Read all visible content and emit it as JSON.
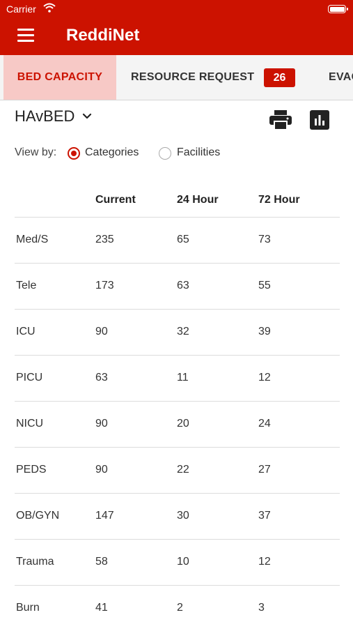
{
  "status_bar": {
    "carrier": "Carrier"
  },
  "app": {
    "title": "ReddiNet"
  },
  "tabs": [
    {
      "label": "BED CAPACITY",
      "active": true
    },
    {
      "label": "RESOURCE REQUEST",
      "badge": "26"
    },
    {
      "label": "EVAC"
    }
  ],
  "selector": {
    "label": "HAvBED"
  },
  "view_by": {
    "label": "View by:",
    "options": [
      {
        "label": "Categories",
        "selected": true
      },
      {
        "label": "Facilities",
        "selected": false
      }
    ]
  },
  "table": {
    "headers": [
      "",
      "Current",
      "24 Hour",
      "72 Hour"
    ],
    "rows": [
      [
        "Med/S",
        "235",
        "65",
        "73"
      ],
      [
        "Tele",
        "173",
        "63",
        "55"
      ],
      [
        "ICU",
        "90",
        "32",
        "39"
      ],
      [
        "PICU",
        "63",
        "11",
        "12"
      ],
      [
        "NICU",
        "90",
        "20",
        "24"
      ],
      [
        "PEDS",
        "90",
        "22",
        "27"
      ],
      [
        "OB/GYN",
        "147",
        "30",
        "37"
      ],
      [
        "Trauma",
        "58",
        "10",
        "12"
      ],
      [
        "Burn",
        "41",
        "2",
        "3"
      ]
    ]
  },
  "colors": {
    "brand": "#cc1200",
    "active_tab_bg": "#f7c9c6"
  },
  "icons": [
    "wifi-icon",
    "battery-icon",
    "menu-icon",
    "chevron-down-icon",
    "print-icon",
    "bar-chart-icon"
  ]
}
